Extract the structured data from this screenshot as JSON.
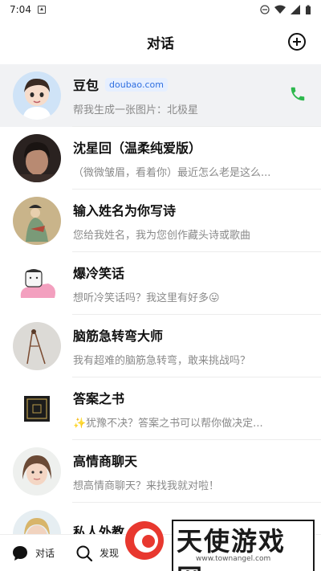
{
  "status": {
    "time": "7:04"
  },
  "header": {
    "title": "对话"
  },
  "chats": [
    {
      "name": "豆包",
      "badge": "doubao.com",
      "message": "帮我生成一张图片：北极星"
    },
    {
      "name": "沈星回（温柔纯爱版）",
      "message": "（微微皱眉，看着你）最近怎么老是这么..."
    },
    {
      "name": "输入姓名为你写诗",
      "message": "您给我姓名，我为您创作藏头诗或歌曲"
    },
    {
      "name": "爆冷笑话",
      "message": "想听冷笑话吗？我这里有好多😛"
    },
    {
      "name": "脑筋急转弯大师",
      "message": "我有超难的脑筋急转弯，敢来挑战吗？"
    },
    {
      "name": "答案之书",
      "message": "✨犹豫不决？答案之书可以帮你做决定..."
    },
    {
      "name": "高情商聊天",
      "message": "想高情商聊天？来找我就对啦！"
    },
    {
      "name": "私人外教",
      "message": ""
    }
  ],
  "tabs": [
    {
      "label": "对话"
    },
    {
      "label": "发现"
    }
  ],
  "watermark": {
    "text": "天使游戏网",
    "url": "www.townangel.com"
  },
  "colors": {
    "accent": "#2f6fe0",
    "phone": "#2db84d",
    "pinned_bg": "#f1f2f4"
  }
}
